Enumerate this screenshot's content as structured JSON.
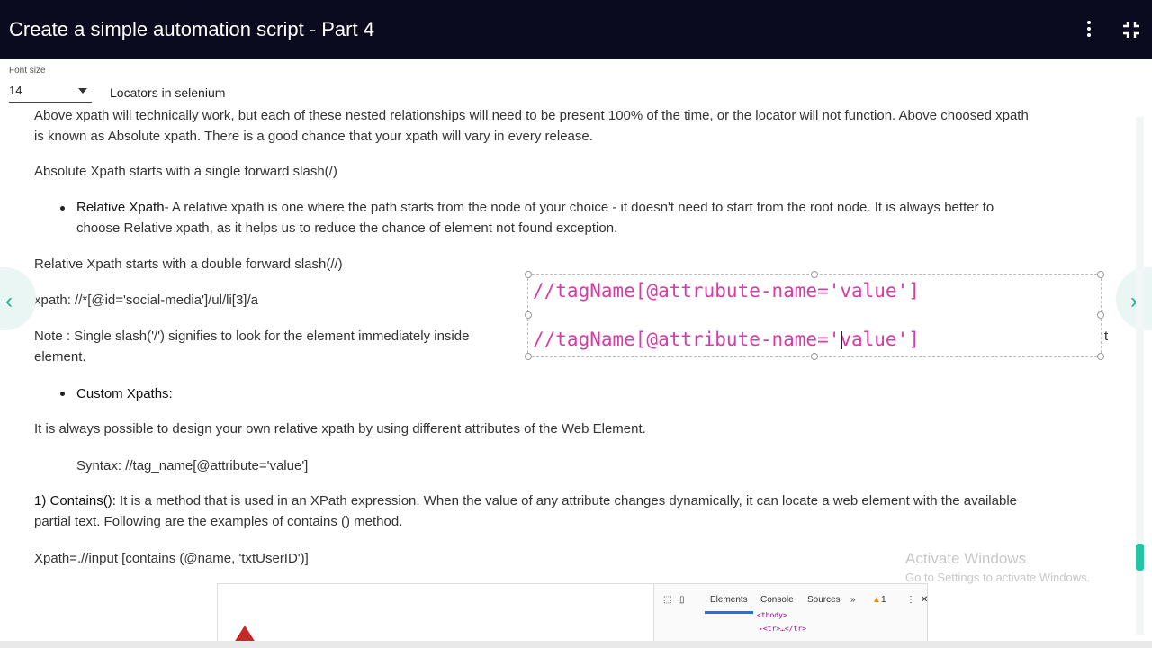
{
  "header": {
    "title": "Create a simple automation script - Part 4",
    "menu_icon": "kebab-menu-icon",
    "collapse_icon": "collapse-icon"
  },
  "toolbar": {
    "font_size_label": "Font size",
    "font_size_value": "14",
    "breadcrumb": "Locators in selenium"
  },
  "content": {
    "line_top_partial": "Above xpath will technically work, but each of these nested relationships will need to be present 100% of the time, or the locator will not function.  Above choosed xpath",
    "line_absolute_known": "is known as Absolute xpath. There is a good chance that your xpath will vary in every release.",
    "absolute_starts": "Absolute Xpath starts with a single forward slash(/)",
    "relative_title": "Relative Xpath",
    "relative_desc_1": "- A relative xpath is one where the path starts from the node of your choice - it doesn't need to start from the root node. It is always better to",
    "relative_desc_2": "choose Relative xpath, as it helps us to reduce the chance of element not found exception.",
    "relative_starts": "Relative Xpath starts with a double forward slash(//)",
    "xpath_example": "xpath: //*[@id='social-media']/ul/li[3]/a",
    "note_line_1": "Note : Single slash('/') signifies to look for the element immediately inside",
    "note_line_1_tail": "t",
    "note_line_2": "element.",
    "custom_title": "Custom Xpaths:",
    "custom_desc": "It is always possible to design your own relative xpath by using different attributes of the Web Element.",
    "syntax": "Syntax: //tag_name[@attribute='value']",
    "contains_title": "1) Contains():",
    "contains_desc_1": " It is a method that is used in an XPath expression. When the value of any attribute changes dynamically, it can locate a web element with the available",
    "contains_desc_2": "partial text. Following are the examples of contains () method.",
    "contains_example": "Xpath=.//input [contains (@name, 'txtUserID')]"
  },
  "overlay": {
    "line1": "//tagName[@attrubute-name='value']",
    "line2": "//tagName[@attribute-name='value']"
  },
  "watermark": {
    "title": "Activate Windows",
    "subtitle": "Go to Settings to activate Windows."
  },
  "devtools": {
    "tabs": [
      "Elements",
      "Console",
      "Sources"
    ],
    "more": "»",
    "warning_count": "1",
    "code_line_1": "<tbody>",
    "code_line_2": "▸<tr>…</tr>"
  },
  "colors": {
    "header_bg": "#0b0b1f",
    "overlay_text": "#d63ca8",
    "accent": "#1ab394"
  }
}
